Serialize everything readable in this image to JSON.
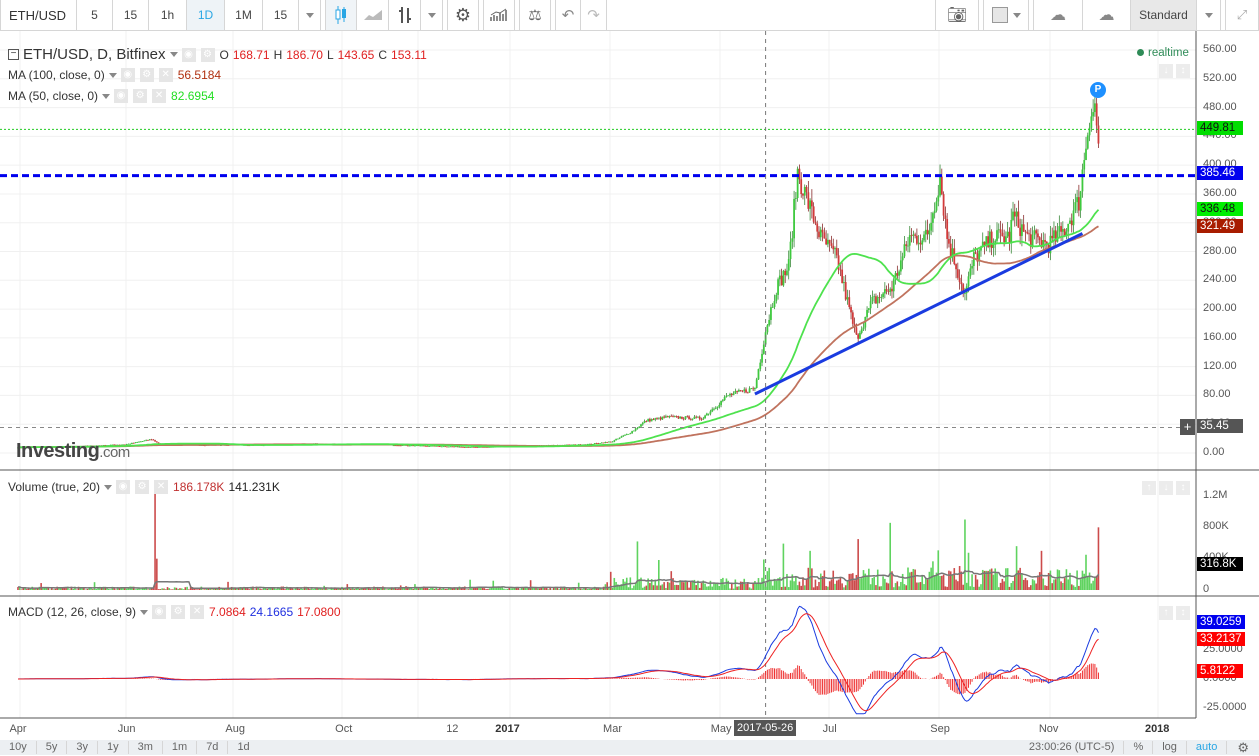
{
  "toolbar": {
    "symbol": "ETH/USD",
    "intervals": [
      "5",
      "15",
      "1h",
      "1D",
      "1M",
      "15"
    ],
    "active_interval": "1D",
    "layout_label": "Standard"
  },
  "legend": {
    "title": "ETH/USD, D, Bitfinex",
    "o_label": "O",
    "o": "168.71",
    "h_label": "H",
    "h": "186.70",
    "l_label": "L",
    "l": "143.65",
    "c_label": "C",
    "c": "153.11",
    "ma100": {
      "label": "MA (100, close, 0)",
      "value": "56.5184"
    },
    "ma50": {
      "label": "MA (50, close, 0)",
      "value": "82.6954"
    },
    "volume": {
      "label": "Volume (true, 20)",
      "value1": "186.178K",
      "value2": "141.231K"
    },
    "macd": {
      "label": "MACD (12, 26, close, 9)",
      "v1": "7.0864",
      "v2": "24.1665",
      "v3": "17.0800"
    },
    "realtime": "realtime",
    "marker": "P",
    "watermark": "Investing",
    "watermark_suffix": ".com"
  },
  "price_axis": [
    "560.00",
    "520.00",
    "480.00",
    "440.00",
    "400.00",
    "360.00",
    "320.00",
    "280.00",
    "240.00",
    "200.00",
    "160.00",
    "120.00",
    "80.00",
    "40.00",
    "0.00"
  ],
  "price_tags": {
    "last": "449.81",
    "hline": "385.46",
    "ma50": "336.48",
    "ma100": "321.49",
    "crosshair": "35.45"
  },
  "volume_axis": [
    "1.2M",
    "800K",
    "400K",
    "0"
  ],
  "volume_tag": "316.8K",
  "macd_axis": [
    "25.0000",
    "0.0000",
    "-25.0000"
  ],
  "macd_tags": {
    "macd": "39.0259",
    "signal": "33.2137",
    "hist": "5.8122"
  },
  "x_axis": [
    {
      "label": "Apr",
      "date": "2016-04-01",
      "bold": false
    },
    {
      "label": "Jun",
      "date": "2016-06-01",
      "bold": false
    },
    {
      "label": "Aug",
      "date": "2016-08-01",
      "bold": false
    },
    {
      "label": "Oct",
      "date": "2016-10-01",
      "bold": false
    },
    {
      "label": "12",
      "date": "2016-12-01",
      "bold": false
    },
    {
      "label": "2017",
      "date": "2017-01-01",
      "bold": true
    },
    {
      "label": "Mar",
      "date": "2017-03-01",
      "bold": false
    },
    {
      "label": "May",
      "date": "2017-05-01",
      "bold": false
    },
    {
      "label": "Jul",
      "date": "2017-07-01",
      "bold": false
    },
    {
      "label": "Sep",
      "date": "2017-09-01",
      "bold": false
    },
    {
      "label": "Nov",
      "date": "2017-11-01",
      "bold": false
    },
    {
      "label": "2018",
      "date": "2018-01-01",
      "bold": true
    }
  ],
  "crosshair_date": "2017-05-26",
  "bottom": {
    "ranges": [
      "10y",
      "5y",
      "3y",
      "1y",
      "3m",
      "1m",
      "7d",
      "1d"
    ],
    "time": "23:00:26 (UTC-5)",
    "percent": "%",
    "log": "log",
    "auto": "auto"
  },
  "colors": {
    "up": "#3ec93e",
    "down": "#d23a3a",
    "ma50": "#4ee24e",
    "ma100": "#c0735e",
    "hline": "#0000ee",
    "trend": "#1a3be0",
    "macd": "#1a3be0",
    "signal": "#ee2222"
  },
  "chart_data": {
    "type": "candlestick",
    "title": "ETH/USD, D, Bitfinex",
    "ylim": [
      0,
      560
    ],
    "key_closes": [
      [
        "2016-04-01",
        8
      ],
      [
        "2016-05-01",
        9
      ],
      [
        "2016-06-01",
        12
      ],
      [
        "2016-06-15",
        19
      ],
      [
        "2016-06-20",
        12
      ],
      [
        "2016-07-15",
        11
      ],
      [
        "2016-08-15",
        11
      ],
      [
        "2016-09-15",
        12.5
      ],
      [
        "2016-10-15",
        12
      ],
      [
        "2016-11-15",
        10
      ],
      [
        "2016-12-15",
        8
      ],
      [
        "2017-01-15",
        10
      ],
      [
        "2017-02-15",
        12
      ],
      [
        "2017-03-01",
        16
      ],
      [
        "2017-03-12",
        30
      ],
      [
        "2017-03-20",
        45
      ],
      [
        "2017-04-01",
        50
      ],
      [
        "2017-04-20",
        48
      ],
      [
        "2017-05-05",
        80
      ],
      [
        "2017-05-20",
        90
      ],
      [
        "2017-05-26",
        170
      ],
      [
        "2017-06-01",
        230
      ],
      [
        "2017-06-08",
        260
      ],
      [
        "2017-06-13",
        390
      ],
      [
        "2017-06-20",
        340
      ],
      [
        "2017-06-26",
        300
      ],
      [
        "2017-07-05",
        270
      ],
      [
        "2017-07-16",
        160
      ],
      [
        "2017-07-25",
        210
      ],
      [
        "2017-08-05",
        230
      ],
      [
        "2017-08-15",
        300
      ],
      [
        "2017-08-25",
        300
      ],
      [
        "2017-09-01",
        385
      ],
      [
        "2017-09-05",
        300
      ],
      [
        "2017-09-15",
        220
      ],
      [
        "2017-09-20",
        270
      ],
      [
        "2017-10-01",
        300
      ],
      [
        "2017-10-10",
        300
      ],
      [
        "2017-10-12",
        330
      ],
      [
        "2017-10-20",
        300
      ],
      [
        "2017-11-01",
        290
      ],
      [
        "2017-11-10",
        310
      ],
      [
        "2017-11-18",
        350
      ],
      [
        "2017-11-24",
        470
      ],
      [
        "2017-11-27",
        480
      ],
      [
        "2017-11-29",
        430
      ]
    ],
    "volume_spikes": [
      [
        "2016-06-17",
        1300000
      ],
      [
        "2016-06-18",
        400000
      ],
      [
        "2017-03-15",
        620000
      ],
      [
        "2017-06-20",
        500000
      ],
      [
        "2017-07-17",
        650000
      ],
      [
        "2017-09-15",
        900000
      ],
      [
        "2017-10-28",
        500000
      ],
      [
        "2017-11-22",
        450000
      ],
      [
        "2017-11-29",
        800000
      ]
    ],
    "hline": 385.46,
    "last_price_line": 449.81,
    "trendline": [
      [
        "2017-05-20",
        82
      ],
      [
        "2017-11-20",
        305
      ]
    ],
    "volume_ylim": [
      0,
      1300000
    ],
    "macd_ylim": [
      -30,
      70
    ]
  }
}
